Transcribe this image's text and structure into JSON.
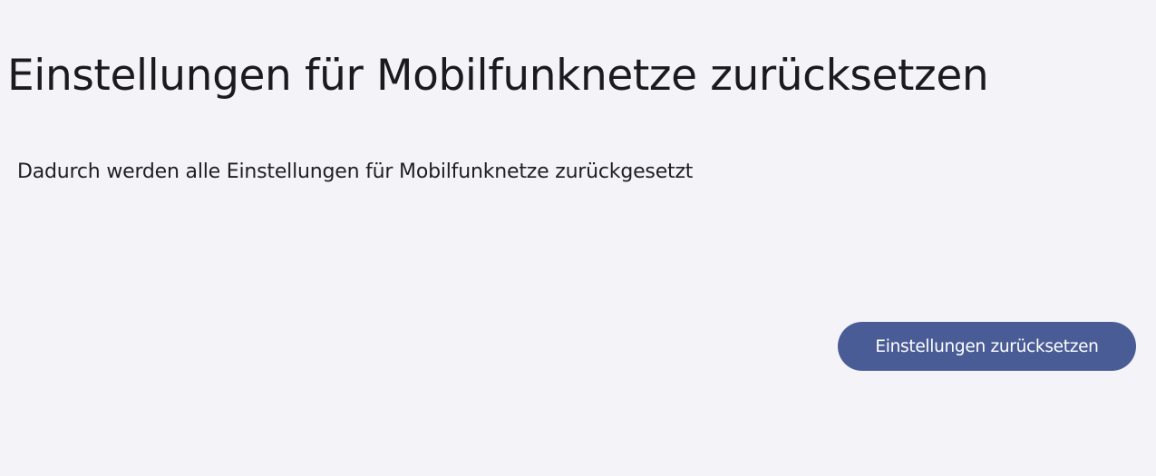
{
  "page": {
    "title": "Einstellungen für Mobilfunknetze zurücksetzen",
    "description": "Dadurch werden alle Einstellungen für Mobilfunknetze zurückgesetzt"
  },
  "actions": {
    "reset_label": "Einstellungen zurücksetzen"
  },
  "colors": {
    "background": "#f4f3f7",
    "primary_button": "#4a5c96",
    "button_text": "#ffffff",
    "text": "#1b1b1f"
  }
}
